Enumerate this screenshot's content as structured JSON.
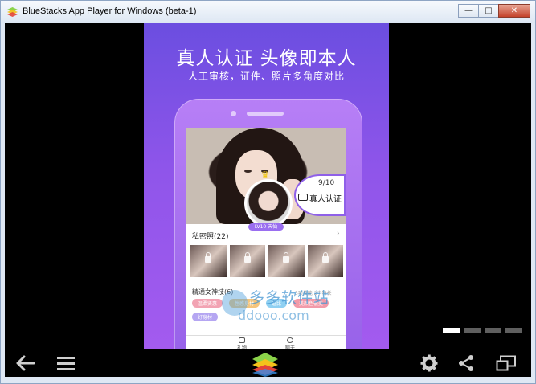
{
  "window": {
    "title": "BlueStacks App Player for Windows (beta-1)",
    "minimize_glyph": "—",
    "maximize_glyph": "□",
    "close_glyph": "✕"
  },
  "app_screen": {
    "headline": "真人认证 头像即本人",
    "subline": "人工审核，证件、照片多角度对比",
    "profile": {
      "level_badge": "LV10 天仙",
      "verify_count": "9/10",
      "verify_label": "真人认证"
    },
    "album": {
      "title": "私密照(22)",
      "chevron": "›",
      "thumbnail_count": 4
    },
    "skills": {
      "title": "精通女神技(6)",
      "meta": "3项技能 2个特长",
      "tags": [
        {
          "text": "温柔贤惠",
          "color": "#f2a3b3"
        },
        {
          "text": "性感身材",
          "color": "#f5c57c"
        },
        {
          "text": "逗比",
          "color": "#8fd0f2"
        },
        {
          "text": "美颜色很美",
          "color": "#f29aa9"
        },
        {
          "text": "好身材",
          "color": "#b5a6f2"
        }
      ]
    },
    "tabs": [
      {
        "label": "礼物"
      },
      {
        "label": "聊天"
      }
    ]
  },
  "watermark": {
    "text": "多多软件站",
    "url": "ddooo.com"
  },
  "pager": {
    "pages": 4,
    "active_index": 0
  },
  "icons": {
    "back": "back-arrow-icon",
    "menu": "menu-icon",
    "home": "bluestacks-logo",
    "settings": "gear-icon",
    "share": "share-icon",
    "window": "window-toggle-icon"
  }
}
